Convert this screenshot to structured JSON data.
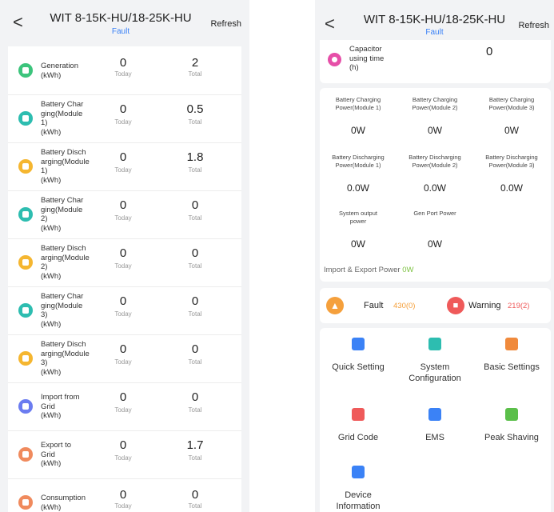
{
  "header": {
    "back_glyph": "<",
    "title": "WIT 8-15K-HU/18-25K-HU",
    "status": "Fault",
    "refresh": "Refresh"
  },
  "energy_list": [
    {
      "label": "Generation\n(kWh)",
      "today": "0",
      "total": "2",
      "icon": "solar-icon",
      "color": "#3cc47c"
    },
    {
      "label": "Battery Char\nging(Module\n1)\n(kWh)",
      "today": "0",
      "total": "0.5",
      "icon": "battery-charge-icon",
      "color": "#2dbdb0"
    },
    {
      "label": "Battery Disch\narging(Module\n1)\n(kWh)",
      "today": "0",
      "total": "1.8",
      "icon": "battery-discharge-icon",
      "color": "#f5b630"
    },
    {
      "label": "Battery Char\nging(Module\n2)\n(kWh)",
      "today": "0",
      "total": "0",
      "icon": "battery-charge-icon",
      "color": "#2dbdb0"
    },
    {
      "label": "Battery Disch\narging(Module\n2)\n(kWh)",
      "today": "0",
      "total": "0",
      "icon": "battery-discharge-icon",
      "color": "#f5b630"
    },
    {
      "label": "Battery Char\nging(Module\n3)\n(kWh)",
      "today": "0",
      "total": "0",
      "icon": "battery-charge-icon",
      "color": "#2dbdb0"
    },
    {
      "label": "Battery Disch\narging(Module\n3)\n(kWh)",
      "today": "0",
      "total": "0",
      "icon": "battery-discharge-icon",
      "color": "#f5b630"
    },
    {
      "label": "Import from\nGrid\n(kWh)",
      "today": "0",
      "total": "0",
      "icon": "grid-tower-icon",
      "color": "#6b7cf0"
    },
    {
      "label": "Export to\nGrid\n(kWh)",
      "today": "0",
      "total": "1.7",
      "icon": "export-icon",
      "color": "#f08a5d"
    },
    {
      "label": "Consumption\n(kWh)",
      "today": "0",
      "total": "0",
      "icon": "consumption-icon",
      "color": "#f08a5d"
    }
  ],
  "today_caption": "Today",
  "total_caption": "Total",
  "capacitor": {
    "label": "Capacitor\nusing time\n(h)",
    "value": "0",
    "icon": "capacitor-icon",
    "color": "#e64fa8"
  },
  "power_grid": [
    {
      "label": "Battery Charging\nPower(Module 1)",
      "value": "0W"
    },
    {
      "label": "Battery Charging\nPower(Module 2)",
      "value": "0W"
    },
    {
      "label": "Battery Charging\nPower(Module 3)",
      "value": "0W"
    },
    {
      "label": "Battery Discharging\nPower(Module 1)",
      "value": "0.0W"
    },
    {
      "label": "Battery Discharging\nPower(Module 2)",
      "value": "0.0W"
    },
    {
      "label": "Battery Discharging\nPower(Module 3)",
      "value": "0.0W"
    },
    {
      "label": "System output\npower",
      "value": "0W"
    },
    {
      "label": "Gen Port Power",
      "value": "0W"
    }
  ],
  "import_export": {
    "label": "Import & Export Power",
    "value": "0W",
    "value_color": "#7dc242"
  },
  "alerts": {
    "fault": {
      "label": "Fault",
      "value": "430(0)",
      "color": "#f5a03c",
      "icon": "fault-triangle-icon"
    },
    "warning": {
      "label": "Warning",
      "value": "219(2)",
      "color": "#ef5a5a",
      "icon": "warning-bell-icon"
    }
  },
  "menu": [
    {
      "label": "Quick Setting",
      "icon": "quick-setting-icon",
      "color": "#3b82f6"
    },
    {
      "label": "System\nConfiguration",
      "icon": "system-config-icon",
      "color": "#2dbdb0"
    },
    {
      "label": "Basic Settings",
      "icon": "basic-settings-icon",
      "color": "#f08a3c"
    },
    {
      "label": "Grid Code",
      "icon": "grid-code-icon",
      "color": "#ef5a5a"
    },
    {
      "label": "EMS",
      "icon": "ems-icon",
      "color": "#3b82f6"
    },
    {
      "label": "Peak Shaving",
      "icon": "peak-shaving-icon",
      "color": "#5bbf4a"
    },
    {
      "label": "Device\nInformation",
      "icon": "device-info-icon",
      "color": "#3b82f6"
    }
  ]
}
